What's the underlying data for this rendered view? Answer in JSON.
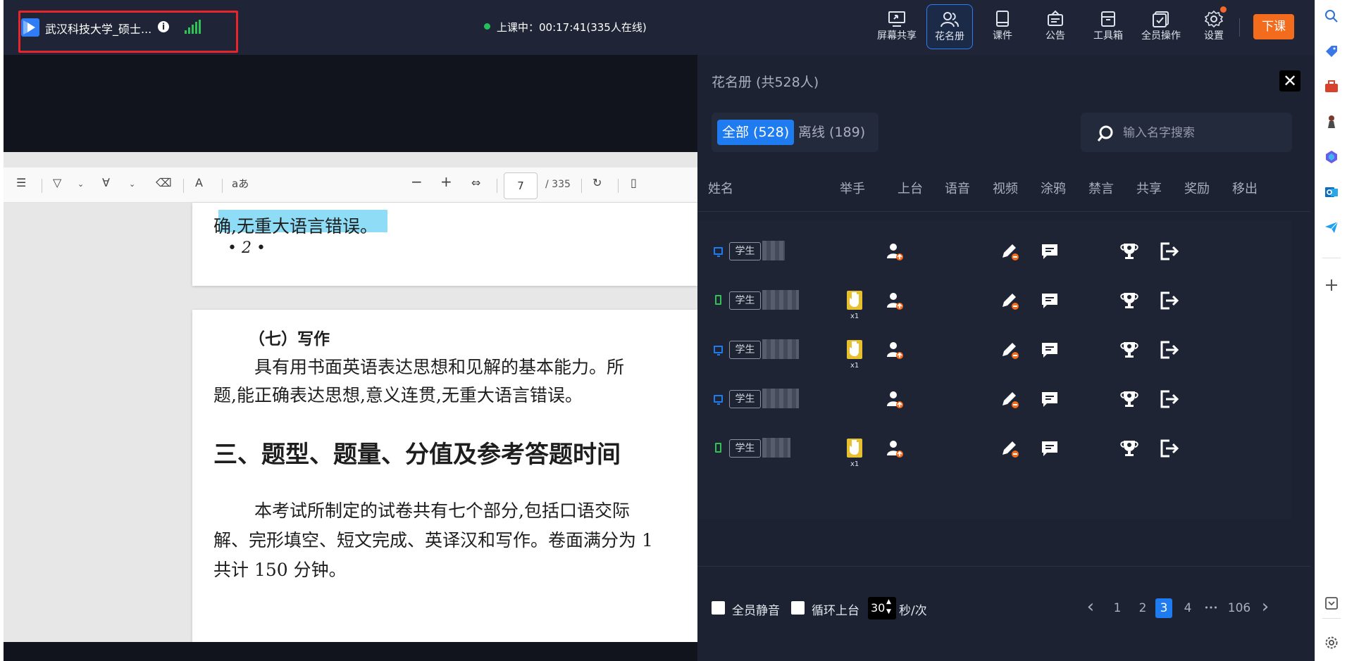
{
  "window": {
    "class_title": "武汉科技大学_硕士...",
    "status": "上课中：00:17:41(335人在线)"
  },
  "toolbar": {
    "items": [
      {
        "label": "屏幕共享",
        "icon": "screen-share-icon"
      },
      {
        "label": "花名册",
        "icon": "roster-icon",
        "active": true
      },
      {
        "label": "课件",
        "icon": "courseware-icon"
      },
      {
        "label": "公告",
        "icon": "announcement-icon"
      },
      {
        "label": "工具箱",
        "icon": "toolbox-icon"
      },
      {
        "label": "全员操作",
        "icon": "all-members-icon"
      },
      {
        "label": "设置",
        "icon": "gear-icon"
      }
    ],
    "end_class_label": "下课"
  },
  "pdf": {
    "page_current": "7",
    "page_total": "/ 335",
    "upper_text": "确,无重大语言错误。",
    "upper_page_number": "• 2 •",
    "section_heading": "（七）写作",
    "para1_line1": "具有用书面英语表达思想和见解的基本能力。所",
    "para1_line2": "题,能正确表达思想,意义连贯,无重大语言错误。",
    "big_heading": "三、题型、题量、分值及参考答题时间",
    "para2_line1": "本考试所制定的试卷共有七个部分,包括口语交际",
    "para2_line2": "解、完形填空、短文完成、英译汉和写作。卷面满分为 1",
    "para2_line3": "共计 150 分钟。"
  },
  "roster": {
    "title": "花名册 (共528人)",
    "tab_all": "全部 (528)",
    "tab_offline": "离线 (189)",
    "search_placeholder": "输入名字搜索",
    "columns": [
      "姓名",
      "举手",
      "上台",
      "语音",
      "视频",
      "涂鸦",
      "禁言",
      "共享",
      "奖励",
      "移出"
    ],
    "rows": [
      {
        "device": "pc",
        "role": "学生",
        "raised_hand": false
      },
      {
        "device": "mobile",
        "role": "学生",
        "raised_hand": true,
        "hand_count": "x1"
      },
      {
        "device": "pc",
        "role": "学生",
        "raised_hand": true,
        "hand_count": "x1"
      },
      {
        "device": "pc",
        "role": "学生",
        "raised_hand": false
      },
      {
        "device": "mobile",
        "role": "学生",
        "raised_hand": true,
        "hand_count": "x1"
      }
    ],
    "footer": {
      "mute_all_label": "全员静音",
      "loop_stage_label": "循环上台",
      "interval_value": "30",
      "interval_unit": "秒/次"
    },
    "pagination": {
      "prev": "‹",
      "pages": [
        "1",
        "2",
        "3",
        "4",
        "•••",
        "106"
      ],
      "current_page": "3",
      "next": "›"
    }
  },
  "colors": {
    "accent": "#1f7cf0",
    "end_class": "#f36b1c",
    "hand_yellow": "#e6c02f",
    "online_green": "#24c15a"
  }
}
